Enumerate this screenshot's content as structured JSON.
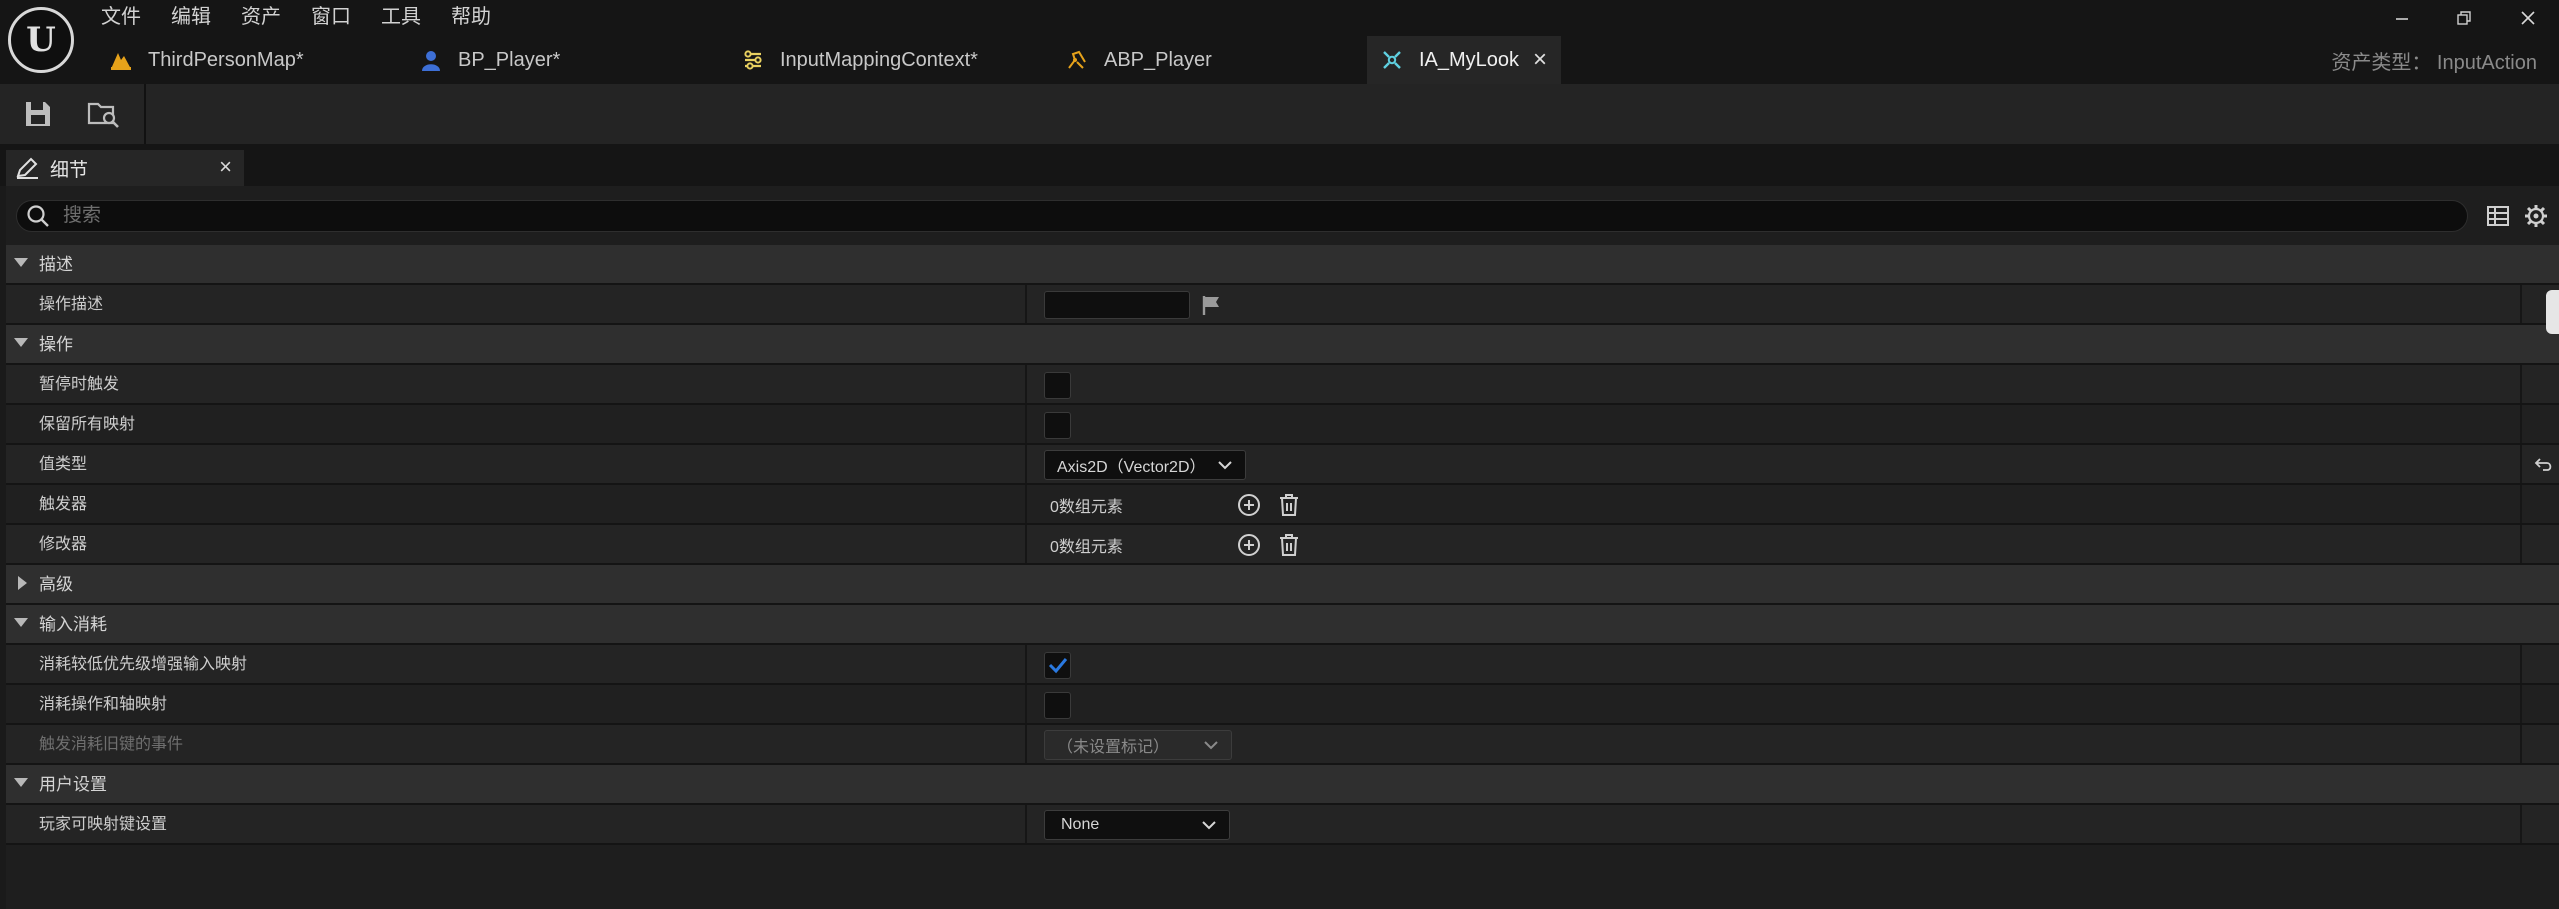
{
  "window": {
    "menu": [
      "文件",
      "编辑",
      "资产",
      "窗口",
      "工具",
      "帮助"
    ],
    "controls": {
      "minimize": "–",
      "restore": "❐",
      "close": "✕"
    }
  },
  "tabs": [
    {
      "label": "ThirdPersonMap*",
      "icon": "level-map-icon",
      "active": false
    },
    {
      "label": "BP_Player*",
      "icon": "blueprint-pawn-icon",
      "active": false
    },
    {
      "label": "InputMappingContext*",
      "icon": "input-mapping-icon",
      "active": false
    },
    {
      "label": "ABP_Player",
      "icon": "anim-blueprint-icon",
      "active": true
    },
    {
      "label": "IA_MyLook",
      "icon": "input-action-icon",
      "active": true,
      "close": "×"
    }
  ],
  "asset_type": "资产类型： InputAction",
  "toolbar": {
    "save_icon": "save-icon",
    "browse_icon": "browse-asset-icon"
  },
  "details": {
    "tab_label": "细节",
    "tab_close": "×",
    "search_placeholder": "搜索",
    "categories": {
      "describe": "描述",
      "action": "操作",
      "advanced": "高级",
      "input_consume": "输入消耗",
      "user_settings": "用户设置"
    },
    "props": {
      "action_description": "操作描述",
      "trigger_when_paused": "暂停时触发",
      "reserve_all_mappings": "保留所有映射",
      "value_type": "值类型",
      "triggers": "触发器",
      "modifiers": "修改器",
      "consume_lower_priority": "消耗较低优先级增强输入映射",
      "consume_action_axis": "消耗操作和轴映射",
      "trigger_legacy_events": "触发消耗旧键的事件",
      "player_mappable_settings": "玩家可映射键设置"
    },
    "values": {
      "value_type": "Axis2D（Vector2D）",
      "triggers_count": "0数组元素",
      "modifiers_count": "0数组元素",
      "legacy_events": "（未设置标记）",
      "player_mappable": "None"
    },
    "checked": {
      "trigger_when_paused": false,
      "reserve_all_mappings": false,
      "consume_lower_priority": true,
      "consume_action_axis": false
    }
  },
  "colors": {
    "accent_blue": "#2a79e0",
    "active_tab_icon": "#5fd0e0",
    "map_icon": "#e6a21a",
    "pawn_icon": "#3d6fd6",
    "mapping_icon": "#e8d060"
  }
}
